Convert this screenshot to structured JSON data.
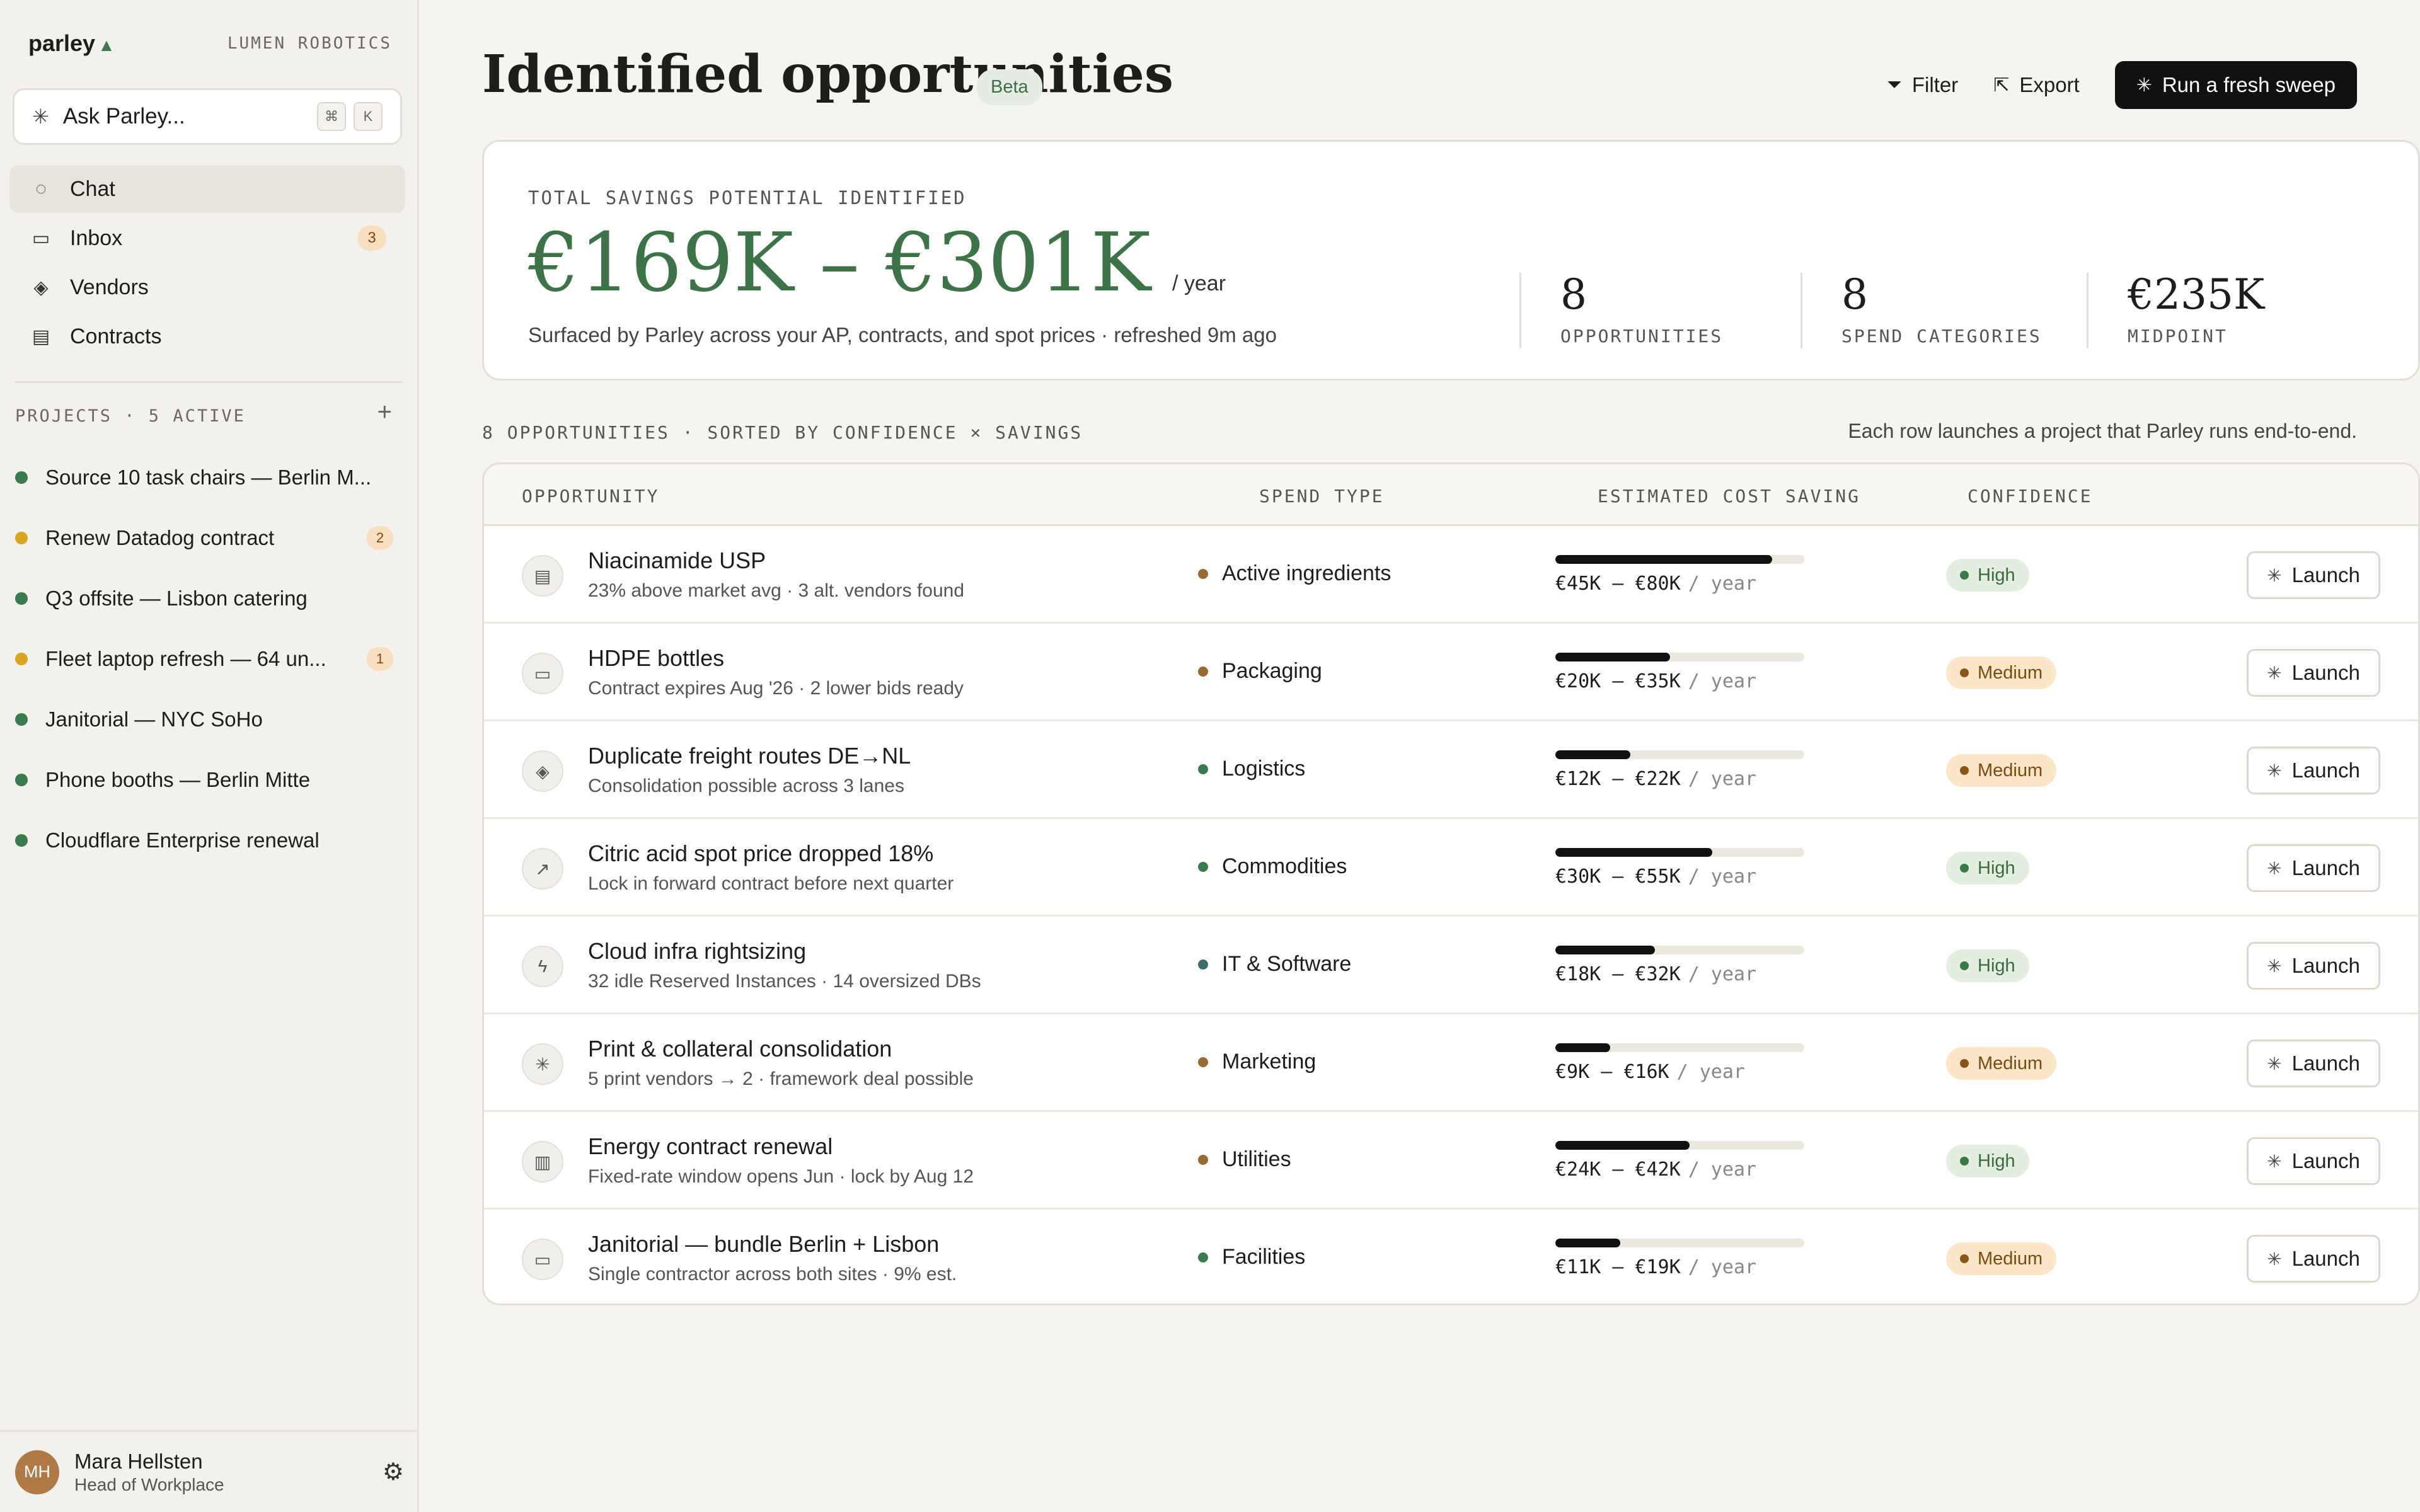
{
  "app": {
    "brand": "parley",
    "brand_mark": "▲",
    "org": "LUMEN ROBOTICS"
  },
  "ask": {
    "label": "Ask Parley...",
    "kbd1": "⌘",
    "kbd2": "K"
  },
  "nav": [
    {
      "label": "Chat",
      "icon": "chat-bubble-icon",
      "glyph": "◌",
      "count": ""
    },
    {
      "label": "Inbox",
      "icon": "inbox-icon",
      "glyph": "▭",
      "count": "3"
    },
    {
      "label": "Vendors",
      "icon": "layers-icon",
      "glyph": "◈",
      "count": ""
    },
    {
      "label": "Contracts",
      "icon": "document-icon",
      "glyph": "▤",
      "count": ""
    }
  ],
  "projects": {
    "heading": "PROJECTS · 5 ACTIVE",
    "add": "+",
    "items": [
      {
        "name": "Source 10 task chairs — Berlin M...",
        "color": "#3b7a4f",
        "badge": ""
      },
      {
        "name": "Renew Datadog contract",
        "color": "#d9a520",
        "badge": "2"
      },
      {
        "name": "Q3 offsite — Lisbon catering",
        "color": "#3b7a4f",
        "badge": ""
      },
      {
        "name": "Fleet laptop refresh — 64 un...",
        "color": "#d9a520",
        "badge": "1"
      },
      {
        "name": "Janitorial — NYC SoHo",
        "color": "#3b7a4f",
        "badge": ""
      },
      {
        "name": "Phone booths — Berlin Mitte",
        "color": "#3b7a4f",
        "badge": ""
      },
      {
        "name": "Cloudflare Enterprise renewal",
        "color": "#3b7a4f",
        "badge": ""
      }
    ]
  },
  "user": {
    "initials": "MH",
    "name": "Mara Hellsten",
    "role": "Head of Workplace"
  },
  "header": {
    "title": "Identified opportunities",
    "badge": "Beta",
    "filter": "Filter",
    "export": "Export",
    "primary": "Run a fresh sweep"
  },
  "summary": {
    "label": "TOTAL SAVINGS POTENTIAL IDENTIFIED",
    "value": "€169K – €301K",
    "unit": "/ year",
    "sub": "Surfaced by Parley across your AP, contracts, and spot prices · refreshed 9m ago",
    "stats": [
      {
        "num": "8",
        "cap": "OPPORTUNITIES"
      },
      {
        "num": "8",
        "cap": "SPEND CATEGORIES"
      },
      {
        "num": "€235K",
        "cap": "MIDPOINT"
      }
    ]
  },
  "list": {
    "heading": "8 OPPORTUNITIES · SORTED BY CONFIDENCE × SAVINGS",
    "note": "Each row launches a project that Parley runs end-to-end.",
    "columns": {
      "opportunity": "OPPORTUNITY",
      "spend": "SPEND TYPE",
      "saving": "ESTIMATED COST SAVING",
      "confidence": "CONFIDENCE"
    },
    "per": "/ year",
    "launch": "Launch",
    "rows": [
      {
        "icon": "document-icon",
        "glyph": "▤",
        "title": "Niacinamide USP",
        "sub": "23% above market avg · 3 alt. vendors found",
        "spend": "Active ingredients",
        "spend_color": "#9a6a33",
        "saving": "€45K – €80K",
        "level": 0.87,
        "confidence": "High"
      },
      {
        "icon": "folder-icon",
        "glyph": "▭",
        "title": "HDPE bottles",
        "sub": "Contract expires Aug '26 · 2 lower bids ready",
        "spend": "Packaging",
        "spend_color": "#9a6a33",
        "saving": "€20K – €35K",
        "level": 0.46,
        "confidence": "Medium"
      },
      {
        "icon": "layers-icon",
        "glyph": "◈",
        "title": "Duplicate freight routes DE→NL",
        "sub": "Consolidation possible across 3 lanes",
        "spend": "Logistics",
        "spend_color": "#3b7a4f",
        "saving": "€12K – €22K",
        "level": 0.3,
        "confidence": "Medium"
      },
      {
        "icon": "trending-up-icon",
        "glyph": "↗",
        "title": "Citric acid spot price dropped 18%",
        "sub": "Lock in forward contract before next quarter",
        "spend": "Commodities",
        "spend_color": "#3b7a4f",
        "saving": "€30K – €55K",
        "level": 0.63,
        "confidence": "High"
      },
      {
        "icon": "bolt-icon",
        "glyph": "ϟ",
        "title": "Cloud infra rightsizing",
        "sub": "32 idle Reserved Instances · 14 oversized DBs",
        "spend": "IT & Software",
        "spend_color": "#3b6f6a",
        "saving": "€18K – €32K",
        "level": 0.4,
        "confidence": "High"
      },
      {
        "icon": "spinner-icon",
        "glyph": "✳",
        "title": "Print & collateral consolidation",
        "sub": "5 print vendors → 2 · framework deal possible",
        "spend": "Marketing",
        "spend_color": "#9a6a33",
        "saving": "€9K – €16K",
        "level": 0.22,
        "confidence": "Medium"
      },
      {
        "icon": "building-icon",
        "glyph": "▥",
        "title": "Energy contract renewal",
        "sub": "Fixed-rate window opens Jun · lock by Aug 12",
        "spend": "Utilities",
        "spend_color": "#9a6a33",
        "saving": "€24K – €42K",
        "level": 0.54,
        "confidence": "High"
      },
      {
        "icon": "folder-icon",
        "glyph": "▭",
        "title": "Janitorial — bundle Berlin + Lisbon",
        "sub": "Single contractor across both sites · 9% est.",
        "spend": "Facilities",
        "spend_color": "#3b7a4f",
        "saving": "€11K – €19K",
        "level": 0.26,
        "confidence": "Medium"
      }
    ]
  }
}
